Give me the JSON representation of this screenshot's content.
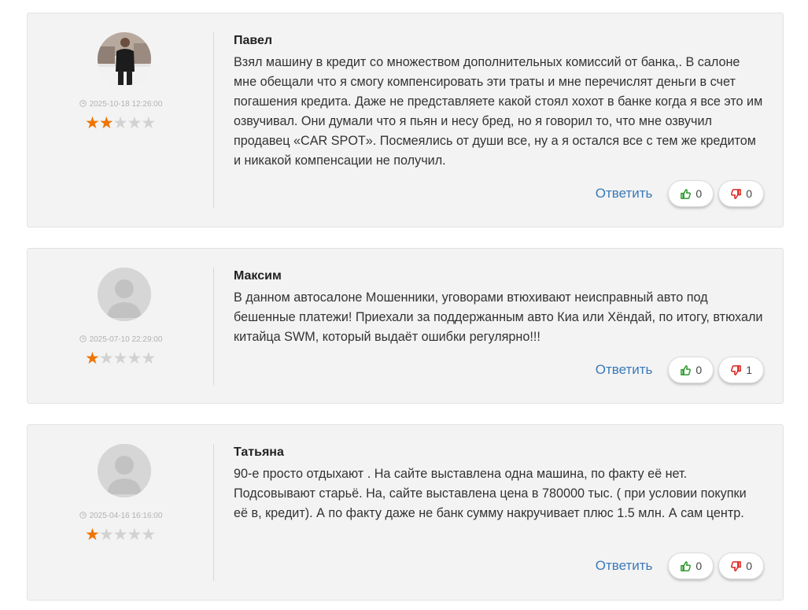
{
  "reviews": [
    {
      "author": "Павел",
      "date": "2025-10-18 12:26:00",
      "rating": 2,
      "avatar": "user-photo",
      "text": "Взял машину в кредит со множеством дополнительных комиссий от банка,. В салоне мне обещали что я смогу компенсировать эти траты и мне перечислят деньги в счет погашения кредита. Даже не представляете какой стоял хохот в банке когда я все это им озвучивал. Они думали что я пьян и несу бред, но я говорил то, что мне озвучил продавец «CAR SPOT». Посмеялись от души все, ну а я остался все с тем же кредитом и никакой компенсации не получил.",
      "reply_label": "Ответить",
      "likes": "0",
      "dislikes": "0"
    },
    {
      "author": "Максим",
      "date": "2025-07-10 22:29:00",
      "rating": 1,
      "avatar": "default-avatar",
      "text": "В данном автосалоне Мошенники, уговорами втюхивают неисправный авто под бешенные платежи! Приехали за поддержанным авто Киа или Хёндай, по итогу, втюхали китайца SWM, который выдаёт ошибки регулярно!!!",
      "reply_label": "Ответить",
      "likes": "0",
      "dislikes": "1"
    },
    {
      "author": "Татьяна",
      "date": "2025-04-16 16:16:00",
      "rating": 1,
      "avatar": "default-avatar",
      "text": "90-е просто отдыхают . На сайте выставлена одна машина, по факту её нет. Подсовывают старьё. На, сайте выставлена цена в 780000 тыс. ( при условии покупки её в, кредит). А по факту даже не банк сумму накручивает плюс 1.5 млн. А сам центр.",
      "reply_label": "Ответить",
      "likes": "0",
      "dislikes": "0"
    }
  ],
  "colors": {
    "star_active": "#f07400",
    "star_inactive": "#d2d2d2",
    "reply_link": "#3a79b7",
    "like": "#2e9a2e",
    "dislike": "#d9251f"
  }
}
